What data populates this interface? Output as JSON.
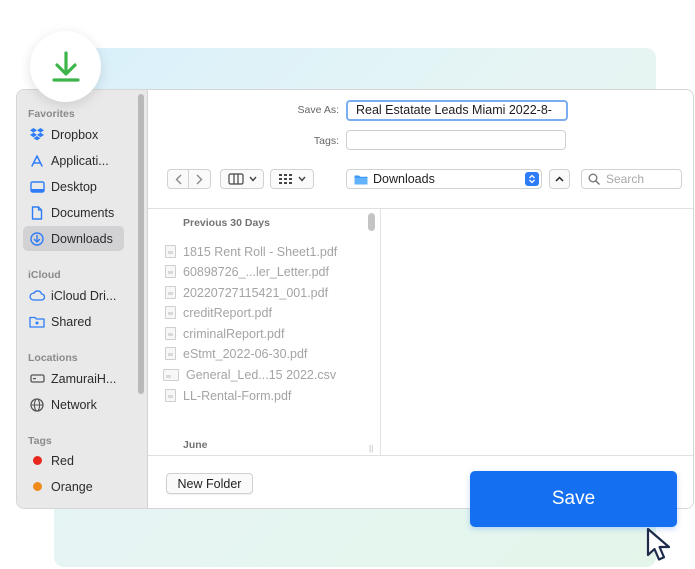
{
  "dialog": {
    "save_as_label": "Save As:",
    "save_as_value": "Real Estatate Leads Miami 2022-8-",
    "tags_label": "Tags:",
    "tags_value": "",
    "location": "Downloads",
    "search_placeholder": "Search"
  },
  "sidebar": {
    "favorites_header": "Favorites",
    "favorites": [
      "Dropbox",
      "Applicati...",
      "Desktop",
      "Documents",
      "Downloads"
    ],
    "icloud_header": "iCloud",
    "icloud": [
      "iCloud Dri...",
      "Shared"
    ],
    "locations_header": "Locations",
    "locations": [
      "ZamuraiH...",
      "Network"
    ],
    "tags_header": "Tags",
    "tags": [
      {
        "label": "Red",
        "color": "#e8281f"
      },
      {
        "label": "Orange",
        "color": "#f08a1c"
      }
    ]
  },
  "browser": {
    "section1": "Previous 30 Days",
    "files": [
      "1815 Rent Roll - Sheet1.pdf",
      "60898726_...ler_Letter.pdf",
      "20220727115421_001.pdf",
      "creditReport.pdf",
      "criminalReport.pdf",
      "eStmt_2022-06-30.pdf",
      "General_Led...15 2022.csv",
      "LL-Rental-Form.pdf"
    ],
    "section2": "June"
  },
  "footer": {
    "new_folder": "New Folder",
    "save": "Save"
  },
  "colors": {
    "accent": "#1470f0",
    "download_green": "#3db54a"
  }
}
